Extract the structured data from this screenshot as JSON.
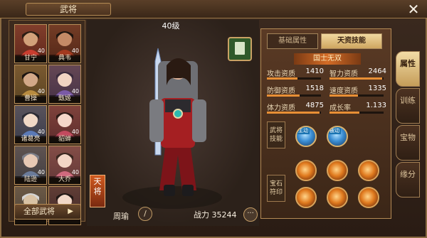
{
  "header": {
    "title": "武将",
    "close_icon": "close-icon"
  },
  "heroes": [
    {
      "name": "甘宁",
      "level": "40",
      "face": "#d2a17a",
      "hair": "#2b1d14",
      "accent": "#c93d2f"
    },
    {
      "name": "典韦",
      "level": "40",
      "face": "#c48a66",
      "hair": "#1e1510",
      "accent": "#a33a1f"
    },
    {
      "name": "曹操",
      "level": "40",
      "face": "#d2a888",
      "hair": "#1c1511",
      "accent": "#b88b3f"
    },
    {
      "name": "甄姬",
      "level": "40",
      "face": "#f1d4c2",
      "hair": "#3a2b3d",
      "accent": "#7a5aa6"
    },
    {
      "name": "诸葛亮",
      "level": "40",
      "face": "#f0d8c6",
      "hair": "#2a2a33",
      "accent": "#5a79b6"
    },
    {
      "name": "貂蝉",
      "level": "40",
      "face": "#f4d6c9",
      "hair": "#2c1b17",
      "accent": "#c24a5e"
    },
    {
      "name": "陆逊",
      "level": "40",
      "face": "#e6c8b4",
      "hair": "#7b7d87",
      "accent": "#6a7b9a"
    },
    {
      "name": "大乔",
      "level": "40",
      "face": "#f3d5c5",
      "hair": "#3a2720",
      "accent": "#d06a7e"
    },
    {
      "name": "",
      "level": "",
      "face": "#d9c2a4",
      "hair": "#d4d4d4",
      "accent": "#8d8a7a"
    },
    {
      "name": "",
      "level": "",
      "face": "#f1d7c7",
      "hair": "#211815",
      "accent": "#6c3b4e"
    }
  ],
  "all_heroes_label": "全部武将",
  "center": {
    "level": "40级",
    "rank_text": "天将",
    "hero_name": "周瑜",
    "power_label": "战力",
    "power_value": "35244"
  },
  "panel": {
    "tab_base": "基础属性",
    "tab_talent": "天资技能",
    "motto": "国士无双",
    "stats": [
      {
        "label": "攻击资质",
        "value": "1410",
        "fill": 0.56
      },
      {
        "label": "智力资质",
        "value": "2464",
        "fill": 0.98
      },
      {
        "label": "防御资质",
        "value": "1518",
        "fill": 0.6
      },
      {
        "label": "速度资质",
        "value": "1335",
        "fill": 0.53
      },
      {
        "label": "体力资质",
        "value": "4875",
        "fill": 0.97
      },
      {
        "label": "成长率",
        "value": "1.133",
        "fill": 0.55
      }
    ],
    "skills_label": "武将技能",
    "skills": [
      {
        "tag": "主动",
        "icon": "water-skill-icon"
      },
      {
        "tag": "被动",
        "icon": "ice-skill-icon"
      }
    ],
    "runes_label": "宝石符印",
    "runes": [
      "fire-rune-icon",
      "fire-rune-icon",
      "fire-rune-icon",
      "fire-rune-icon",
      "fire-rune-icon",
      "fire-rune-icon"
    ]
  },
  "side_tabs": [
    "属性",
    "训练",
    "宝物",
    "缘分"
  ],
  "colors": {
    "accent": "#e88f35",
    "gold": "#cfa660",
    "panel": "#3b2617"
  }
}
